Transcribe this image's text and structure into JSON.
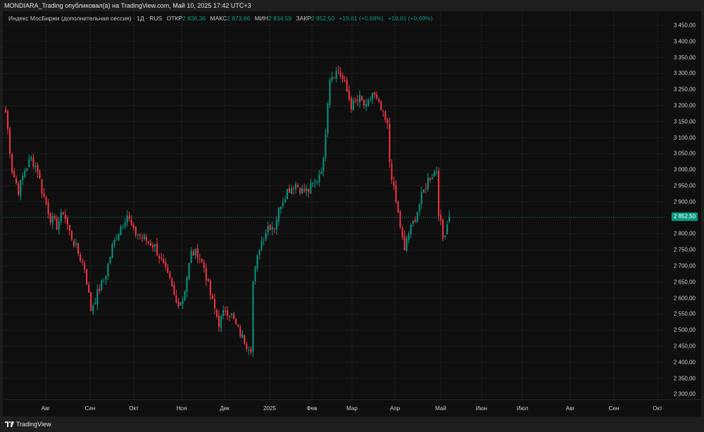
{
  "header": {
    "publisher_line": "MONDIARA_Trading опубликовал(а) на TradingView.com, Май 10, 2025 17:42 UTC+3"
  },
  "legend": {
    "symbol": "Индекс МосБиржи (дополнительная сессия) · 1Д · RUS",
    "open_label": "ОТКР",
    "open": "2 836,36",
    "high_label": "МАКС",
    "high": "2 873,66",
    "low_label": "МИН",
    "low": "2 834,59",
    "close_label": "ЗАКР",
    "close": "2 852,50",
    "change1": "+19,61 (+0,69%)",
    "change2": "+19,61 (+0,69%)"
  },
  "price_axis": {
    "ticks": [
      "3 450,00",
      "3 400,00",
      "3 350,00",
      "3 300,00",
      "3 250,00",
      "3 200,00",
      "3 150,00",
      "3 100,00",
      "3 050,00",
      "3 000,00",
      "2 950,00",
      "2 900,00",
      "2 850,00",
      "2 800,00",
      "2 750,00",
      "2 700,00",
      "2 650,00",
      "2 600,00",
      "2 550,00",
      "2 500,00",
      "2 450,00",
      "2 400,00",
      "2 350,00",
      "2 300,00"
    ],
    "tick_values": [
      3450,
      3400,
      3350,
      3300,
      3250,
      3200,
      3150,
      3100,
      3050,
      3000,
      2950,
      2900,
      2850,
      2800,
      2750,
      2700,
      2650,
      2600,
      2550,
      2500,
      2450,
      2400,
      2350,
      2300
    ],
    "last_price": "2 852,50",
    "last_value": 2852.5
  },
  "time_axis": {
    "ticks": [
      "Авг",
      "Сен",
      "Окт",
      "Ноя",
      "Дек",
      "2025",
      "Фев",
      "Мар",
      "Апр",
      "Май",
      "Июн",
      "Июл",
      "Авг",
      "Сен",
      "Окт"
    ]
  },
  "colors": {
    "up": "#089981",
    "down": "#f23645"
  },
  "chart_data": {
    "type": "candlestick",
    "interval": "1D",
    "keypoint_closes": [
      [
        0,
        3180
      ],
      [
        1,
        3125
      ],
      [
        3,
        3000
      ],
      [
        6,
        2935
      ],
      [
        9,
        3000
      ],
      [
        12,
        3035
      ],
      [
        15,
        3000
      ],
      [
        17,
        2935
      ],
      [
        21,
        2850
      ],
      [
        24,
        2825
      ],
      [
        27,
        2870
      ],
      [
        30,
        2805
      ],
      [
        34,
        2740
      ],
      [
        37,
        2695
      ],
      [
        40,
        2565
      ],
      [
        44,
        2630
      ],
      [
        47,
        2675
      ],
      [
        50,
        2760
      ],
      [
        54,
        2825
      ],
      [
        57,
        2860
      ],
      [
        60,
        2805
      ],
      [
        63,
        2795
      ],
      [
        67,
        2775
      ],
      [
        70,
        2760
      ],
      [
        73,
        2715
      ],
      [
        77,
        2650
      ],
      [
        80,
        2585
      ],
      [
        83,
        2595
      ],
      [
        87,
        2740
      ],
      [
        90,
        2740
      ],
      [
        93,
        2695
      ],
      [
        96,
        2610
      ],
      [
        100,
        2520
      ],
      [
        103,
        2565
      ],
      [
        106,
        2545
      ],
      [
        109,
        2500
      ],
      [
        113,
        2455
      ],
      [
        115,
        2445
      ],
      [
        116,
        2650
      ],
      [
        119,
        2760
      ],
      [
        123,
        2825
      ],
      [
        126,
        2825
      ],
      [
        129,
        2895
      ],
      [
        132,
        2935
      ],
      [
        136,
        2955
      ],
      [
        139,
        2935
      ],
      [
        142,
        2935
      ],
      [
        146,
        2970
      ],
      [
        149,
        3025
      ],
      [
        151,
        3220
      ],
      [
        152,
        3290
      ],
      [
        156,
        3310
      ],
      [
        159,
        3265
      ],
      [
        162,
        3200
      ],
      [
        166,
        3220
      ],
      [
        169,
        3190
      ],
      [
        172,
        3240
      ],
      [
        175,
        3200
      ],
      [
        179,
        3135
      ],
      [
        180,
        3025
      ],
      [
        182,
        2935
      ],
      [
        185,
        2825
      ],
      [
        187,
        2740
      ],
      [
        188,
        2785
      ],
      [
        192,
        2850
      ],
      [
        195,
        2915
      ],
      [
        198,
        2970
      ],
      [
        202,
        3000
      ],
      [
        203,
        2870
      ],
      [
        205,
        2785
      ],
      [
        207,
        2833
      ],
      [
        208,
        2852.5
      ]
    ],
    "last_candle": {
      "open": 2836.36,
      "high": 2873.66,
      "low": 2834.59,
      "close": 2852.5
    },
    "ylim": [
      2280,
      3470
    ]
  },
  "footer": {
    "brand": "TradingView"
  }
}
